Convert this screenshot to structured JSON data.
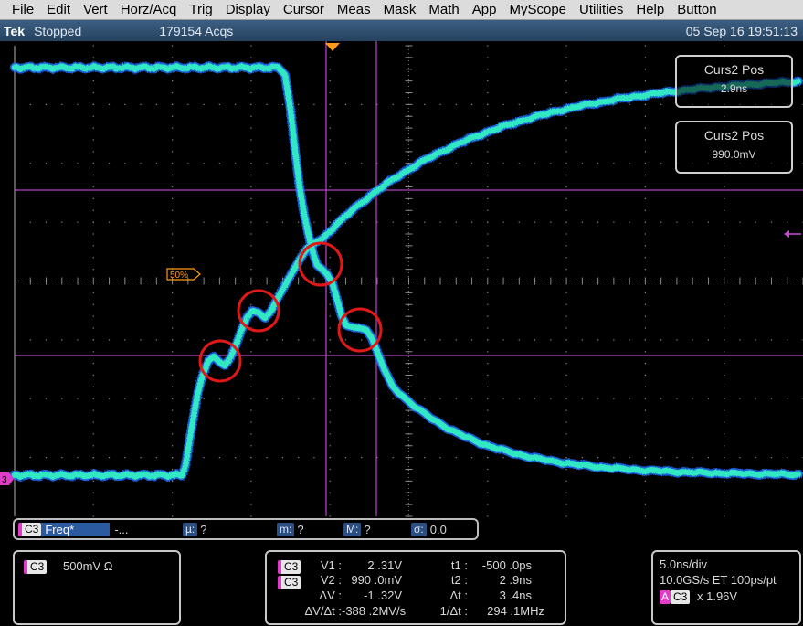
{
  "menu": [
    "File",
    "Edit",
    "Vert",
    "Horz/Acq",
    "Trig",
    "Display",
    "Cursor",
    "Meas",
    "Mask",
    "Math",
    "App",
    "MyScope",
    "Utilities",
    "Help",
    "Button"
  ],
  "status": {
    "brand": "Tek",
    "state": "Stopped",
    "acqs": "179154 Acqs",
    "datetime": "05 Sep 16 19:51:13"
  },
  "cursor_boxes": {
    "time": {
      "label": "Curs2 Pos",
      "value": "2.9ns"
    },
    "volt": {
      "label": "Curs2 Pos",
      "value": "990.0mV"
    }
  },
  "markers": {
    "trigger_level_flag": "50%",
    "channel_ground": "3"
  },
  "measure_strip": {
    "channel": "C3",
    "measurement": "Freq*",
    "value": "-...",
    "mu_label": "µ:",
    "mu_value": "?",
    "m_label": "m:",
    "m_value": "?",
    "M_label": "M:",
    "M_value": "?",
    "sigma_label": "σ:",
    "sigma_value": "0.0"
  },
  "channel_panel": {
    "channel": "C3",
    "scale": "500mV Ω"
  },
  "cursor_readout": {
    "ch1": "C3",
    "ch2": "C3",
    "v1_label": "V1 :",
    "v1": "2 .31V",
    "v2_label": "V2 :",
    "v2": "990 .0mV",
    "dv_label": "ΔV :",
    "dv": "-1 .32V",
    "dvdt_label": "ΔV/Δt :",
    "dvdt": "-388 .2MV/s",
    "t1_label": "t1 :",
    "t1": "-500 .0ps",
    "t2_label": "t2 :",
    "t2": "2 .9ns",
    "dt_label": "Δt :",
    "dt": "3 .4ns",
    "inv_dt_label": "1/Δt :",
    "inv_dt": "294 .1MHz"
  },
  "timebase_panel": {
    "scale": "5.0ns/div",
    "rate": "10.0GS/s ET 100ps/pt",
    "trigger_source_badge": "A",
    "trigger_channel": "C3",
    "trigger_level": "x 1.96V"
  },
  "colors": {
    "trace": "#33e8c2",
    "trace_halo": "#1f6cff",
    "cursor": "#b040c0",
    "annotation": "#e01818",
    "grid": "#8a8a8a",
    "trigger_marker": "#ff9a1a"
  }
}
